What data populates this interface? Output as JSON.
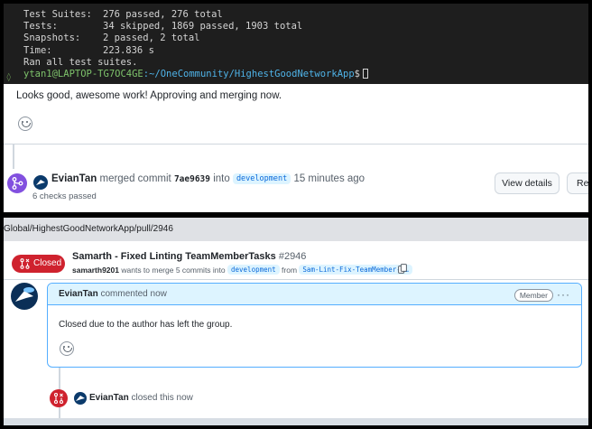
{
  "terminal": {
    "rows": [
      {
        "key": "Test Suites:",
        "value": "276 passed, 276 total"
      },
      {
        "key": "Tests:",
        "value": "34 skipped, 1869 passed, 1903 total"
      },
      {
        "key": "Snapshots:",
        "value": "2 passed, 2 total"
      },
      {
        "key": "Time:",
        "value": "223.836 s"
      }
    ],
    "footer": "Ran all test suites.",
    "prompt_user": "ytan1@LAPTOP-TG7OC4GE",
    "prompt_path": ":~/OneCommunity/HighestGoodNetworkApp",
    "prompt_symbol": "$"
  },
  "comment1": {
    "body": "Looks good, awesome work! Approving and merging now."
  },
  "merge_event": {
    "author": "EvianTan",
    "action": "merged commit",
    "sha": "7ae9639",
    "into": "into",
    "branch": "development",
    "time": "15 minutes ago",
    "checks": "6 checks passed",
    "view_details_label": "View details",
    "revert_label": "Revert"
  },
  "browser": {
    "url_fragment": "Global/HighestGoodNetworkApp/pull/2946"
  },
  "pr": {
    "status": "Closed",
    "title": "Samarth - Fixed Linting TeamMemberTasks",
    "number": "#2946",
    "author": "samarth9201",
    "meta_text": "wants to merge 5 commits into",
    "base_branch": "development",
    "from_text": "from",
    "head_branch": "Sam-Lint-Fix-TeamMember-T…"
  },
  "comment2": {
    "author": "EvianTan",
    "action": "commented now",
    "badge": "Member",
    "menu": "···",
    "body": "Closed due to the author has left the group."
  },
  "close_event": {
    "author": "EvianTan",
    "action": "closed this now"
  },
  "colors": {
    "closed_red": "#cf222e",
    "merged_purple": "#8250df",
    "link_blue": "#0969da"
  }
}
